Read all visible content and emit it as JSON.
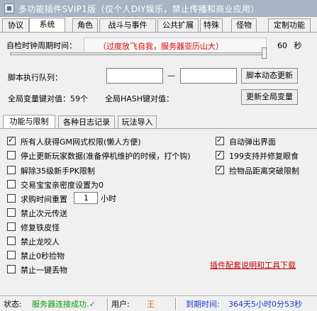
{
  "window": {
    "title": "多功能插件SVIP1版（仅个人DIY娱乐，禁止传播和商业应用）"
  },
  "main_tabs": [
    "协议",
    "系统",
    "角色",
    "战斗与事件",
    "公共扩展",
    "特殊",
    "怪物",
    "定制功能"
  ],
  "main_tabs_active": "系统",
  "timer": {
    "label": "自检时钟周期时间：",
    "slider_text": "（过度放飞自我，服务器亚历山大）",
    "value": "60",
    "unit": "秒"
  },
  "script_queue": {
    "label": "脚本执行队列：",
    "separator": "—",
    "from_value": "",
    "to_value": "",
    "refresh_button": "脚本动态更新"
  },
  "global_vars": {
    "count_text": "全局变量键对值：59个",
    "hash_label": "全局HASH键对值：",
    "update_button": "更新全局变量"
  },
  "sub_tabs": [
    "功能与限制",
    "各种日志记录",
    "玩法导入"
  ],
  "sub_tabs_active": "功能与限制",
  "options_left": [
    {
      "label": "所有人获得GM网式权限(懒人方便)",
      "checked": true
    },
    {
      "label": "停止更新玩家数据(准备停机维护的时候，打个钩)",
      "checked": false
    },
    {
      "label": "解除35级新手PK限制",
      "checked": false
    },
    {
      "label": "交易宝宝亲密度设置为0",
      "checked": false
    },
    {
      "label": "求购时间重置",
      "checked": false
    },
    {
      "label": "禁止次元传送",
      "checked": false
    },
    {
      "label": "修复铁皮怪",
      "checked": false
    },
    {
      "label": "禁止龙咬人",
      "checked": false
    },
    {
      "label": "禁止0秒捡物",
      "checked": false
    },
    {
      "label": "禁止一键丢物",
      "checked": false
    }
  ],
  "options_right": [
    {
      "label": "自动弹出界面",
      "checked": true
    },
    {
      "label": "199支持并修复眼食",
      "checked": true
    },
    {
      "label": "捡物品距离突破限制",
      "checked": true
    }
  ],
  "reset_hours": {
    "value": "1",
    "unit": "小时"
  },
  "link_text": "插件配套说明和工具下载",
  "statusbar": {
    "status_label": "状态:",
    "status_value": "服务器连接成功.✓",
    "user_label": "用户:",
    "user_value": "王",
    "expire_label": "到期时间:",
    "expire_value": "364天5小时0分53秒"
  },
  "colors": {
    "titlebar": "#a8b3c5",
    "warning_red": "#e00000",
    "link_red": "#c00000",
    "status_green": "#0a9a0a",
    "user_orange": "#e07000",
    "expire_blue": "#1a3cc8"
  }
}
